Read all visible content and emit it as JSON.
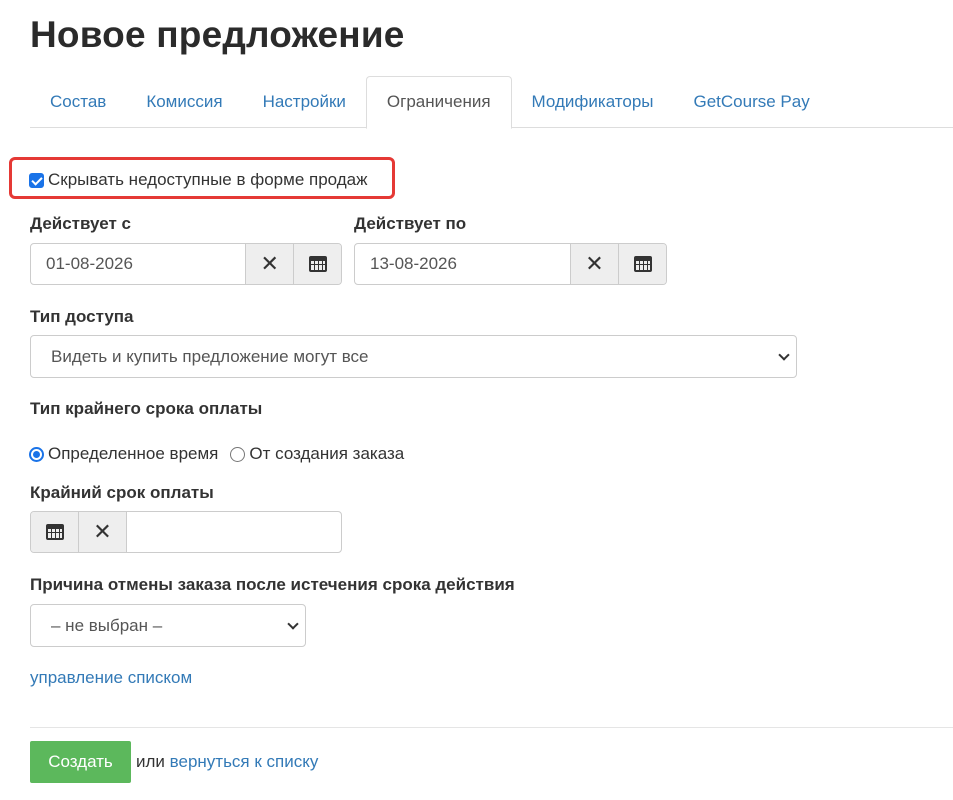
{
  "page": {
    "title": "Новое предложение"
  },
  "tabs": [
    {
      "label": "Состав",
      "active": false
    },
    {
      "label": "Комиссия",
      "active": false
    },
    {
      "label": "Настройки",
      "active": false
    },
    {
      "label": "Ограничения",
      "active": true
    },
    {
      "label": "Модификаторы",
      "active": false
    },
    {
      "label": "GetCourse Pay",
      "active": false
    }
  ],
  "hide_unavailable": {
    "label": "Скрывать недоступные в форме продаж",
    "checked": true
  },
  "valid_from": {
    "label": "Действует с",
    "value": "01-08-2026"
  },
  "valid_to": {
    "label": "Действует по",
    "value": "13-08-2026"
  },
  "access_type": {
    "label": "Тип доступа",
    "selected": "Видеть и купить предложение могут все"
  },
  "deadline_type": {
    "label": "Тип крайнего срока оплаты",
    "options": [
      {
        "label": "Определенное время",
        "selected": true
      },
      {
        "label": "От создания заказа",
        "selected": false
      }
    ]
  },
  "deadline": {
    "label": "Крайний срок оплаты",
    "value": ""
  },
  "cancel_reason": {
    "label": "Причина отмены заказа после истечения срока действия",
    "selected": "– не выбран –"
  },
  "manage_list_link": "управление списком",
  "footer": {
    "create_label": "Создать",
    "or_text": "или",
    "back_link": "вернуться к списку"
  },
  "colors": {
    "link": "#337ab7",
    "primary_button": "#5cb85c",
    "highlight_border": "#e53935",
    "checkbox": "#1a73e8"
  }
}
